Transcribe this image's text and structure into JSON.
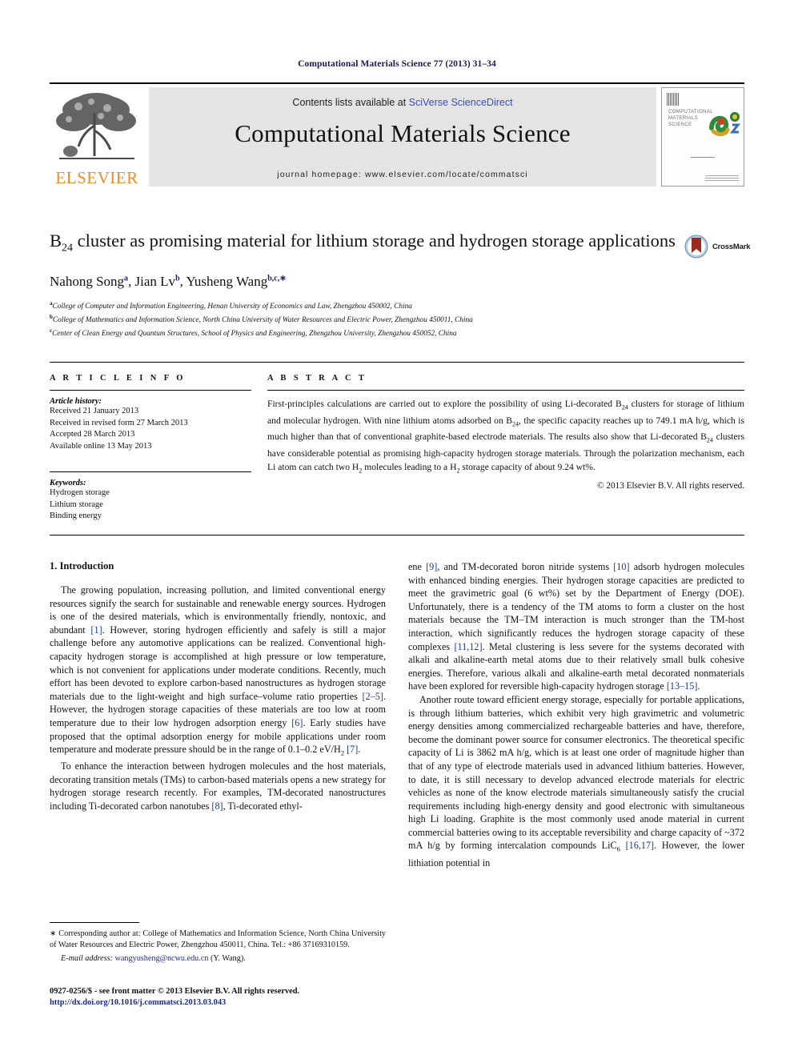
{
  "running_head": "Computational Materials Science 77 (2013) 31–34",
  "masthead": {
    "contents_prefix": "Contents lists available at ",
    "sciencedirect": "SciVerse ScienceDirect",
    "journal_name": "Computational Materials Science",
    "homepage": "journal homepage: www.elsevier.com/locate/commatsci",
    "publisher": "ELSEVIER",
    "cover_title_lines": [
      "COMPUTATIONAL",
      "MATERIALS",
      "SCIENCE"
    ],
    "accent_orange": "#f08a24",
    "band_gray": "#e4e4e4",
    "link_blue": "#3a4fb5"
  },
  "article": {
    "title_part1": "B",
    "title_sub": "24",
    "title_part2": " cluster as promising material for lithium storage and hydrogen storage applications",
    "authors": [
      {
        "name": "Nahong Song",
        "sup": "a"
      },
      {
        "name": "Jian Lv",
        "sup": "b"
      },
      {
        "name": "Yusheng Wang",
        "sup": "b,c,∗"
      }
    ],
    "affiliations": [
      {
        "sup": "a",
        "text": "College of Computer and Information Engineering, Henan University of Economics and Law, Zhengzhou 450002, China"
      },
      {
        "sup": "b",
        "text": "College of Mathematics and Information Science, North China University of Water Resources and Electric Power, Zhengzhou 450011, China"
      },
      {
        "sup": "c",
        "text": "Center of Clean Energy and Quantum Structures, School of Physics and Engineering, Zhengzhou University, Zhengzhou 450052, China"
      }
    ],
    "crossmark_label": "CrossMark"
  },
  "article_info": {
    "heading": "A R T I C L E   I N F O",
    "history_label": "Article history:",
    "history": [
      "Received 21 January 2013",
      "Received in revised form 27 March 2013",
      "Accepted 28 March 2013",
      "Available online 13 May 2013"
    ],
    "keywords_label": "Keywords:",
    "keywords": [
      "Hydrogen storage",
      "Lithium storage",
      "Binding energy"
    ]
  },
  "abstract": {
    "heading": "A B S T R A C T",
    "text_p1": "First-principles calculations are carried out to explore the possibility of using Li-decorated B",
    "sub1": "24",
    "text_p2": " clusters for storage of lithium and molecular hydrogen. With nine lithium atoms adsorbed on B",
    "sub2": "24",
    "text_p3": ", the specific capacity reaches up to 749.1 mA h/g, which is much higher than that of conventional graphite-based electrode materials. The results also show that Li-decorated B",
    "sub3": "24",
    "text_p4": " clusters have considerable potential as promising high-capacity hydrogen storage materials. Through the polarization mechanism, each Li atom can catch two H",
    "sub4": "2",
    "text_p5": " molecules leading to a H",
    "sub5": "2",
    "text_p6": " storage capacity of about 9.24 wt%.",
    "copyright": "© 2013 Elsevier B.V. All rights reserved."
  },
  "body": {
    "section_heading": "1. Introduction",
    "left_paragraph_1_a": "The growing population, increasing pollution, and limited conventional energy resources signify the search for sustainable and renewable energy sources. Hydrogen is one of the desired materials, which is environmentally friendly, nontoxic, and abundant ",
    "left_ref_1": "[1]",
    "left_paragraph_1_b": ". However, storing hydrogen efficiently and safely is still a major challenge before any automotive applications can be realized. Conventional high-capacity hydrogen storage is accomplished at high pressure or low temperature, which is not convenient for applications under moderate conditions. Recently, much effort has been devoted to explore carbon-based nanostructures as hydrogen storage materials due to the light-weight and high surface–volume ratio properties ",
    "left_ref_2": "[2–5]",
    "left_paragraph_1_c": ". However, the hydrogen storage capacities of these materials are too low at room temperature due to their low hydrogen adsorption energy ",
    "left_ref_3": "[6]",
    "left_paragraph_1_d": ". Early studies have proposed that the optimal adsorption energy for mobile applications under room temperature and moderate pressure should be in the range of 0.1–0.2 eV/H",
    "left_sub_1": "2",
    "left_paragraph_1_e": " ",
    "left_ref_4": "[7]",
    "left_paragraph_1_f": ".",
    "left_paragraph_2_a": "To enhance the interaction between hydrogen molecules and the host materials, decorating transition metals (TMs) to carbon-based materials opens a new strategy for hydrogen storage research recently. For examples, TM-decorated nanostructures including Ti-decorated carbon nanotubes ",
    "left_ref_5": "[8]",
    "left_paragraph_2_b": ", Ti-decorated ethyl-",
    "right_paragraph_1_a": "ene ",
    "right_ref_1": "[9]",
    "right_paragraph_1_b": ", and TM-decorated boron nitride systems ",
    "right_ref_2": "[10]",
    "right_paragraph_1_c": " adsorb hydrogen molecules with enhanced binding energies. Their hydrogen storage capacities are predicted to meet the gravimetric goal (6 wt%) set by the Department of Energy (DOE). Unfortunately, there is a tendency of the TM atoms to form a cluster on the host materials because the TM–TM interaction is much stronger than the TM-host interaction, which significantly reduces the hydrogen storage capacity of these complexes ",
    "right_ref_3": "[11,12]",
    "right_paragraph_1_d": ". Metal clustering is less severe for the systems decorated with alkali and alkaline-earth metal atoms due to their relatively small bulk cohesive energies. Therefore, various alkali and alkaline-earth metal decorated nonmaterials have been explored for reversible high-capacity hydrogen storage ",
    "right_ref_4": "[13–15]",
    "right_paragraph_1_e": ".",
    "right_paragraph_2_a": "Another route toward efficient energy storage, especially for portable applications, is through lithium batteries, which exhibit very high gravimetric and volumetric energy densities among commercialized rechargeable batteries and have, therefore, become the dominant power source for consumer electronics. The theoretical specific capacity of Li is 3862 mA h/g, which is at least one order of magnitude higher than that of any type of electrode materials used in advanced lithium batteries. However, to date, it is still necessary to develop advanced electrode materials for electric vehicles as none of the know electrode materials simultaneously satisfy the crucial requirements including high-energy density and good electronic with simultaneous high Li loading. Graphite is the most commonly used anode material in current commercial batteries owing to its acceptable reversibility and charge capacity of ~372 mA h/g by forming intercalation compounds LiC",
    "right_sub_1": "6",
    "right_paragraph_2_b": " ",
    "right_ref_5": "[16,17]",
    "right_paragraph_2_c": ". However, the lower lithiation potential in"
  },
  "footnotes": {
    "corresponding": "∗ Corresponding author at: College of Mathematics and Information Science, North China University of Water Resources and Electric Power, Zhengzhou 450011, China. Tel.: +86 37169310159.",
    "email_label": "E-mail address:",
    "email": "wangyusheng@ncwu.edu.cn",
    "email_suffix": " (Y. Wang)."
  },
  "imprint": {
    "issn_line": "0927-0256/$ - see front matter © 2013 Elsevier B.V. All rights reserved.",
    "doi": "http://dx.doi.org/10.1016/j.commatsci.2013.03.043"
  }
}
